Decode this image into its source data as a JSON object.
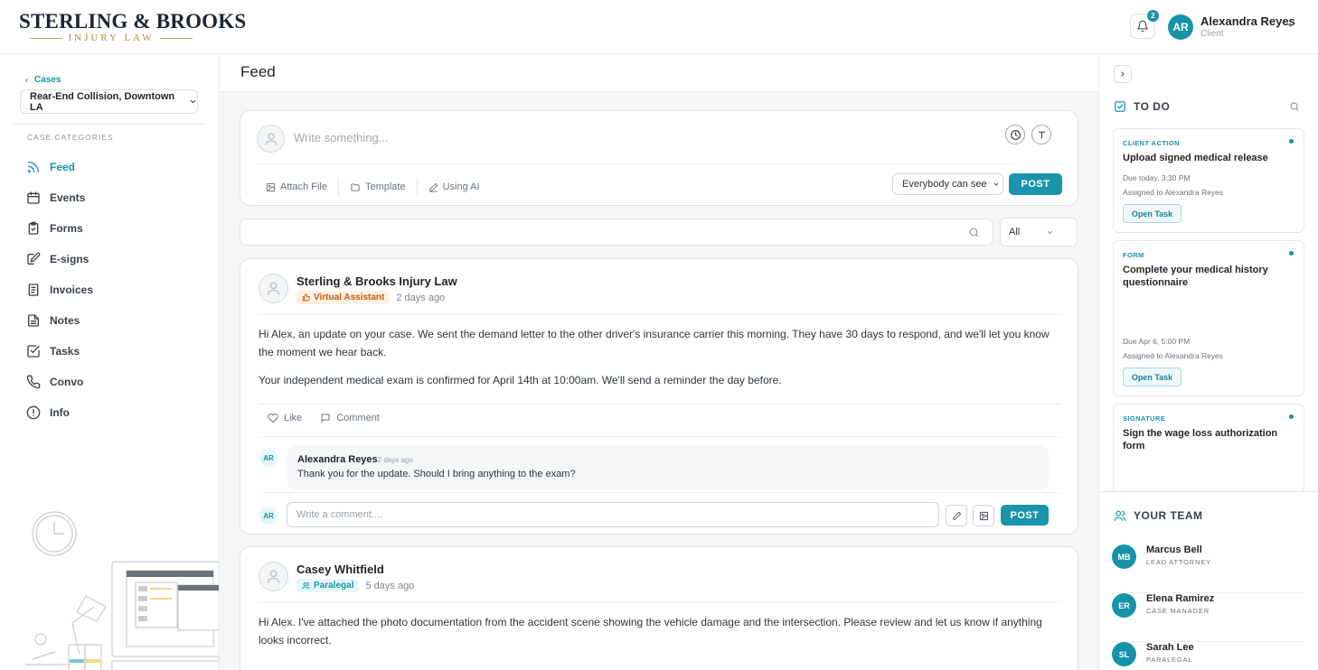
{
  "brand": {
    "name": "STERLING & BROOKS",
    "subtitle": "INJURY LAW"
  },
  "header": {
    "notification_count": "2",
    "user_initials": "AR",
    "user_name": "Alexandra Reyes",
    "user_role": "Client"
  },
  "sidebar": {
    "back_label": "Cases",
    "case_name": "Rear-End Collision, Downtown LA",
    "categories_heading": "CASE CATEGORIES",
    "items": [
      {
        "label": "Feed",
        "icon": "rss-icon",
        "active": true
      },
      {
        "label": "Events",
        "icon": "calendar-icon"
      },
      {
        "label": "Forms",
        "icon": "clipboard-icon"
      },
      {
        "label": "E-signs",
        "icon": "edit-icon"
      },
      {
        "label": "Invoices",
        "icon": "receipt-icon"
      },
      {
        "label": "Notes",
        "icon": "document-icon"
      },
      {
        "label": "Tasks",
        "icon": "checkbox-icon"
      },
      {
        "label": "Convo",
        "icon": "phone-icon"
      },
      {
        "label": "Info",
        "icon": "info-icon"
      }
    ]
  },
  "feed": {
    "title": "Feed",
    "composer": {
      "placeholder": "Write something...",
      "attach_label": "Attach File",
      "template_label": "Template",
      "ai_label": "Using AI",
      "visibility": "Everybody can see",
      "post_label": "POST"
    },
    "filter": {
      "selected": "All"
    },
    "posts": [
      {
        "author": "Sterling & Brooks Injury Law",
        "role": "Virtual Assistant",
        "time": "2 days ago",
        "paragraphs": [
          "Hi Alex, an update on your case. We sent the demand letter to the other driver's insurance carrier this morning. They have 30 days to respond, and we'll let you know the moment we hear back.",
          "Your independent medical exam is confirmed for April 14th at 10:00am. We'll send a reminder the day before."
        ],
        "like_label": "Like",
        "comment_label": "Comment",
        "comment": {
          "initials": "AR",
          "author": "Alexandra Reyes",
          "time": "2 days ago",
          "text": "Thank you for the update. Should I bring anything to the exam?"
        },
        "reply_initials": "AR",
        "reply_placeholder": "Write a comment....",
        "reply_post_label": "POST"
      },
      {
        "author": "Casey Whitfield",
        "role": "Paralegal",
        "time": "5 days ago",
        "paragraphs": [
          "Hi Alex. I've attached the photo documentation from the accident scene showing the vehicle damage and the intersection. Please review and let us know if anything looks incorrect."
        ]
      }
    ]
  },
  "todo": {
    "title": "TO DO",
    "tasks": [
      {
        "category": "CLIENT ACTION",
        "title": "Upload signed medical release",
        "due": "Due today, 3:30 PM",
        "assigned": "Assigned to Alexandra Reyes",
        "button": "Open Task"
      },
      {
        "category": "FORM",
        "title": "Complete your medical history questionnaire",
        "due": "Due Apr 6, 5:00 PM",
        "assigned": "Assigned to Alexandra Reyes",
        "button": "Open Task"
      },
      {
        "category": "SIGNATURE",
        "title": "Sign the wage loss authorization form"
      }
    ]
  },
  "team": {
    "title": "YOUR TEAM",
    "members": [
      {
        "initials": "MB",
        "name": "Marcus Bell",
        "role": "LEAD ATTORNEY"
      },
      {
        "initials": "ER",
        "name": "Elena Ramirez",
        "role": "CASE MANAGER"
      },
      {
        "initials": "SL",
        "name": "Sarah Lee",
        "role": "PARALEGAL"
      }
    ]
  },
  "colors": {
    "accent": "#1793a8",
    "brand_gold": "#b08a3e",
    "va_tag": "#c65b12"
  }
}
